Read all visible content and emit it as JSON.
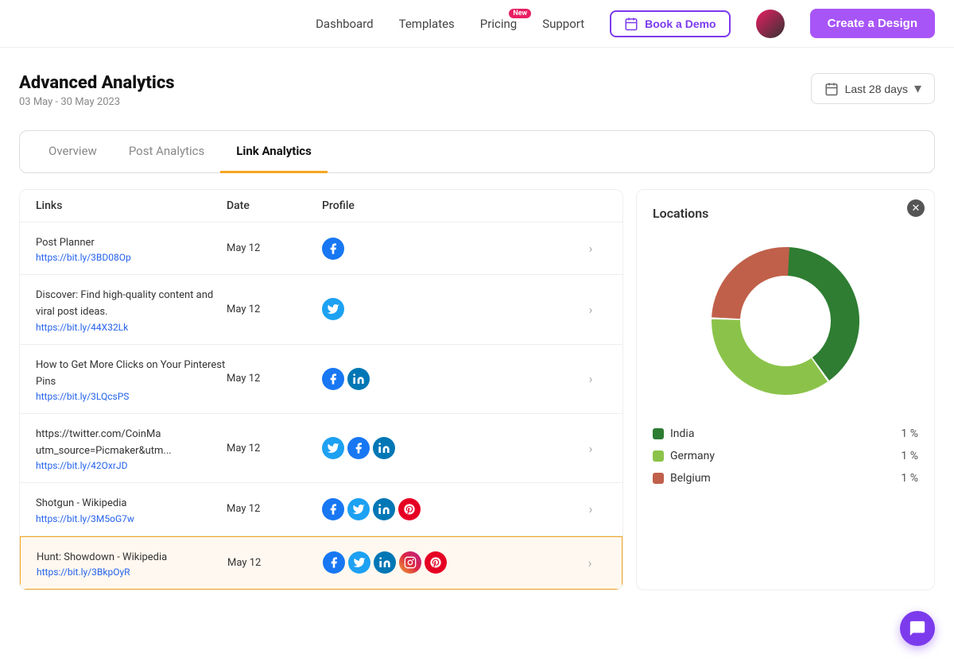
{
  "navbar": {
    "links": [
      {
        "id": "dashboard",
        "label": "Dashboard",
        "badge": null
      },
      {
        "id": "templates",
        "label": "Templates",
        "badge": null
      },
      {
        "id": "pricing",
        "label": "Pricing",
        "badge": "New"
      },
      {
        "id": "support",
        "label": "Support",
        "badge": null
      }
    ],
    "book_demo_label": "Book a Demo",
    "create_design_label": "Create a Design"
  },
  "page": {
    "title": "Advanced Analytics",
    "date_range": "03 May - 30 May 2023",
    "date_filter": "Last 28 days"
  },
  "tabs": [
    {
      "id": "overview",
      "label": "Overview",
      "active": false
    },
    {
      "id": "post-analytics",
      "label": "Post Analytics",
      "active": false
    },
    {
      "id": "link-analytics",
      "label": "Link Analytics",
      "active": true
    }
  ],
  "table": {
    "columns": [
      "Links",
      "Date",
      "Profile"
    ],
    "rows": [
      {
        "id": "row1",
        "title": "Post Planner",
        "url": "https://bit.ly/3BD08Op",
        "date": "May 12",
        "profiles": [
          "fb"
        ],
        "highlighted": false
      },
      {
        "id": "row2",
        "title": "Discover: Find high-quality content and viral post ideas.",
        "url": "https://bit.ly/44X32Lk",
        "date": "May 12",
        "profiles": [
          "tw"
        ],
        "highlighted": false
      },
      {
        "id": "row3",
        "title": "How to Get More Clicks on Your Pinterest Pins",
        "url": "https://bit.ly/3LQcsPS",
        "date": "May 12",
        "profiles": [
          "fb",
          "li"
        ],
        "highlighted": false
      },
      {
        "id": "row4",
        "title": "https://twitter.com/CoinMa utm_source=Picmaker&utm...",
        "url": "https://bit.ly/42OxrJD",
        "date": "May 12",
        "profiles": [
          "tw",
          "fb",
          "li"
        ],
        "highlighted": false
      },
      {
        "id": "row5",
        "title": "Shotgun - Wikipedia",
        "url": "https://bit.ly/3M5oG7w",
        "date": "May 12",
        "profiles": [
          "fb",
          "tw",
          "li",
          "pi"
        ],
        "highlighted": false
      },
      {
        "id": "row6",
        "title": "Hunt: Showdown - Wikipedia",
        "url": "https://bit.ly/3BkpOyR",
        "date": "May 12",
        "profiles": [
          "fb",
          "tw",
          "li",
          "ig",
          "pi"
        ],
        "highlighted": true
      }
    ]
  },
  "locations": {
    "title": "Locations",
    "chart": {
      "segments": [
        {
          "label": "India",
          "color": "#2e7d32",
          "pct": 40,
          "startAngle": 0
        },
        {
          "label": "Germany",
          "color": "#8bc34a",
          "pct": 35,
          "startAngle": 144
        },
        {
          "label": "Belgium",
          "color": "#c0604a",
          "pct": 25,
          "startAngle": 270
        }
      ]
    },
    "legend": [
      {
        "label": "India",
        "color": "#2e7d32",
        "pct": "1 %"
      },
      {
        "label": "Germany",
        "color": "#8bc34a",
        "pct": "1 %"
      },
      {
        "label": "Belgium",
        "color": "#c0604a",
        "pct": "1 %"
      }
    ]
  }
}
